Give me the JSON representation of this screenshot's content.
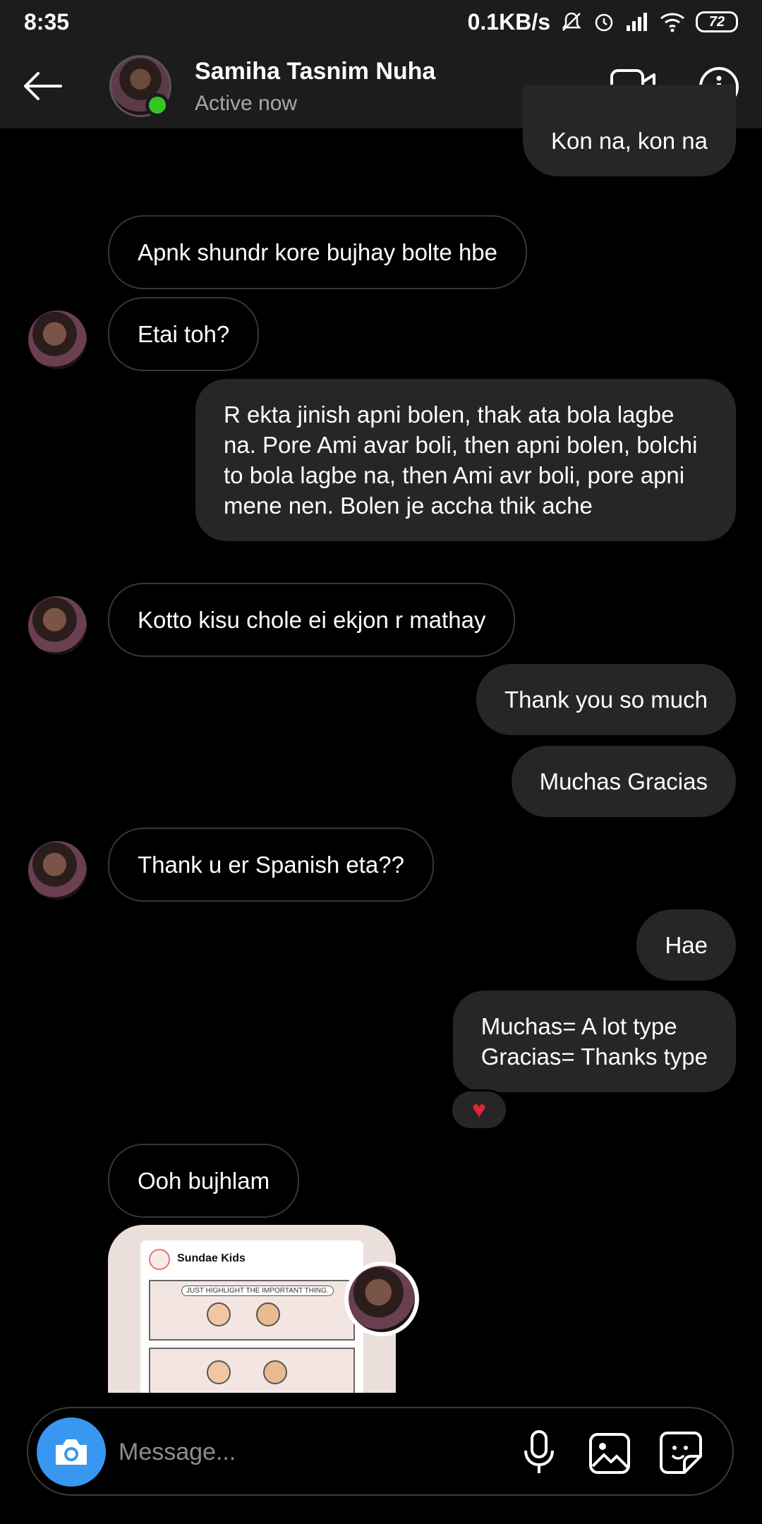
{
  "status_bar": {
    "time": "8:35",
    "net_speed": "0.1KB/s",
    "battery": "72"
  },
  "header": {
    "contact_name": "Samiha Tasnim Nuha",
    "contact_status": "Active now"
  },
  "messages": [
    {
      "direction": "outgoing",
      "text": "Kon na, kon na"
    },
    {
      "direction": "incoming",
      "text": "Apnk shundr kore bujhay bolte hbe"
    },
    {
      "direction": "incoming",
      "text": "Etai toh?"
    },
    {
      "direction": "outgoing",
      "text": "R ekta jinish apni bolen, thak ata bola lagbe na. Pore Ami avar boli, then apni bolen, bolchi to bola lagbe na, then Ami avr boli, pore apni mene nen. Bolen je accha thik ache"
    },
    {
      "direction": "incoming",
      "text": "Kotto kisu chole ei ekjon r mathay"
    },
    {
      "direction": "outgoing",
      "text": "Thank you so much"
    },
    {
      "direction": "outgoing",
      "text": "Muchas Gracias"
    },
    {
      "direction": "incoming",
      "text": "Thank u er Spanish eta??"
    },
    {
      "direction": "outgoing",
      "text": "Hae"
    },
    {
      "direction": "outgoing",
      "text": "Muchas= A lot type\nGracias= Thanks type",
      "reaction": "heart"
    },
    {
      "direction": "incoming",
      "text": "Ooh bujhlam"
    }
  ],
  "shared_post": {
    "account_name": "Sundae Kids",
    "caption": "JUST HIGHLIGHT THE IMPORTANT THING."
  },
  "composer": {
    "placeholder": "Message..."
  },
  "colors": {
    "outgoing_bubble": "#262626",
    "online": "#34c724",
    "camera_button": "#3897f0",
    "reaction_heart": "#e0233a"
  }
}
